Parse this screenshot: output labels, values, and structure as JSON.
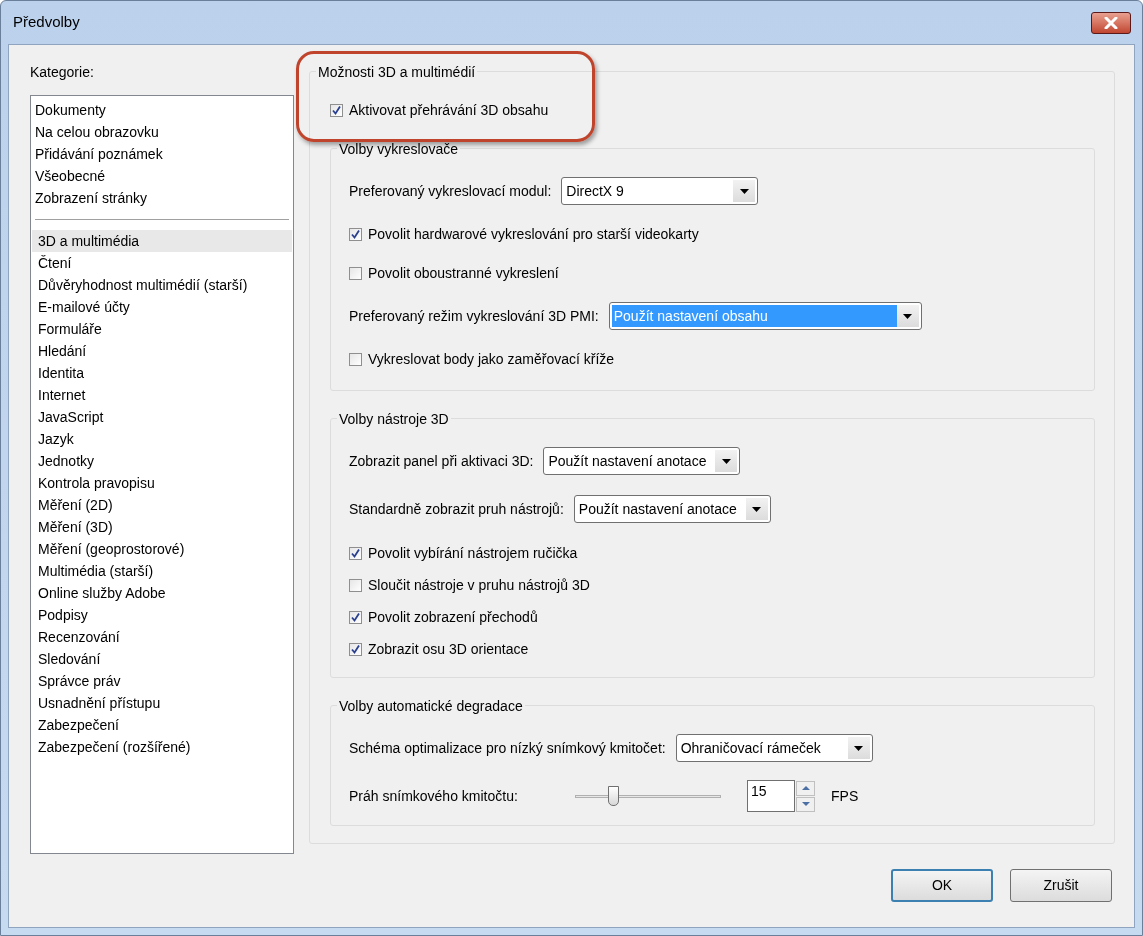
{
  "window": {
    "title": "Předvolby"
  },
  "categories": {
    "label": "Kategorie:",
    "groups": [
      [
        {
          "label": "Dokumenty",
          "selected": false
        },
        {
          "label": "Na celou obrazovku",
          "selected": false
        },
        {
          "label": "Přidávání poznámek",
          "selected": false
        },
        {
          "label": "Všeobecné",
          "selected": false
        },
        {
          "label": "Zobrazení stránky",
          "selected": false
        }
      ],
      [
        {
          "label": "3D a multimédia",
          "selected": true
        },
        {
          "label": "Čtení",
          "selected": false
        },
        {
          "label": "Důvěryhodnost multimédií (starší)",
          "selected": false
        },
        {
          "label": "E-mailové účty",
          "selected": false
        },
        {
          "label": "Formuláře",
          "selected": false
        },
        {
          "label": "Hledání",
          "selected": false
        },
        {
          "label": "Identita",
          "selected": false
        },
        {
          "label": "Internet",
          "selected": false
        },
        {
          "label": "JavaScript",
          "selected": false
        },
        {
          "label": "Jazyk",
          "selected": false
        },
        {
          "label": "Jednotky",
          "selected": false
        },
        {
          "label": "Kontrola pravopisu",
          "selected": false
        },
        {
          "label": "Měření (2D)",
          "selected": false
        },
        {
          "label": "Měření (3D)",
          "selected": false
        },
        {
          "label": "Měření (geoprostorové)",
          "selected": false
        },
        {
          "label": "Multimédia (starší)",
          "selected": false
        },
        {
          "label": "Online služby Adobe",
          "selected": false
        },
        {
          "label": "Podpisy",
          "selected": false
        },
        {
          "label": "Recenzování",
          "selected": false
        },
        {
          "label": "Sledování",
          "selected": false
        },
        {
          "label": "Správce práv",
          "selected": false
        },
        {
          "label": "Usnadnění přístupu",
          "selected": false
        },
        {
          "label": "Zabezpečení",
          "selected": false
        },
        {
          "label": "Zabezpečení (rozšířené)",
          "selected": false
        }
      ]
    ]
  },
  "panel": {
    "title": "Možnosti 3D a multimédií",
    "highlighted": true,
    "enable": {
      "label": "Aktivovat přehrávání 3D obsahu",
      "checked": true
    },
    "sections": [
      {
        "title": "Volby vykreslovače",
        "rows": [
          {
            "kind": "select",
            "label": "Preferovaný vykreslovací modul:",
            "value": "DirectX 9",
            "focused": false
          },
          {
            "kind": "checkbox",
            "label": "Povolit hardwarové vykreslování pro starší videokarty",
            "checked": true
          },
          {
            "kind": "checkbox",
            "label": "Povolit oboustranné vykreslení",
            "checked": false
          },
          {
            "kind": "select",
            "label": "Preferovaný režim vykreslování 3D PMI:",
            "value": "Použít nastavení obsahu",
            "focused": true
          },
          {
            "kind": "checkbox",
            "label": "Vykreslovat body jako zaměřovací kříže",
            "checked": false
          }
        ]
      },
      {
        "title": "Volby nástroje 3D",
        "rows": [
          {
            "kind": "select",
            "label": "Zobrazit panel při aktivaci 3D:",
            "value": "Použít nastavení anotace",
            "focused": false
          },
          {
            "kind": "select",
            "label": "Standardně zobrazit pruh nástrojů:",
            "value": "Použít nastavení anotace",
            "focused": false
          },
          {
            "kind": "checkbox",
            "label": "Povolit vybírání nástrojem ručička",
            "checked": true
          },
          {
            "kind": "checkbox",
            "label": "Sloučit nástroje v pruhu nástrojů 3D",
            "checked": false
          },
          {
            "kind": "checkbox",
            "label": "Povolit zobrazení přechodů",
            "checked": true
          },
          {
            "kind": "checkbox",
            "label": "Zobrazit osu 3D orientace",
            "checked": true
          }
        ]
      },
      {
        "title": "Volby automatické degradace",
        "rows": [
          {
            "kind": "select",
            "label": "Schéma optimalizace pro nízký snímkový kmitočet:",
            "value": "Ohraničovací rámeček",
            "focused": false
          },
          {
            "kind": "slider",
            "label": "Práh snímkového kmitočtu:",
            "level": 0.26,
            "value": "15",
            "unit": "FPS"
          }
        ]
      }
    ]
  },
  "buttons": [
    {
      "label": "OK",
      "default": true
    },
    {
      "label": "Zrušit",
      "default": false
    }
  ]
}
